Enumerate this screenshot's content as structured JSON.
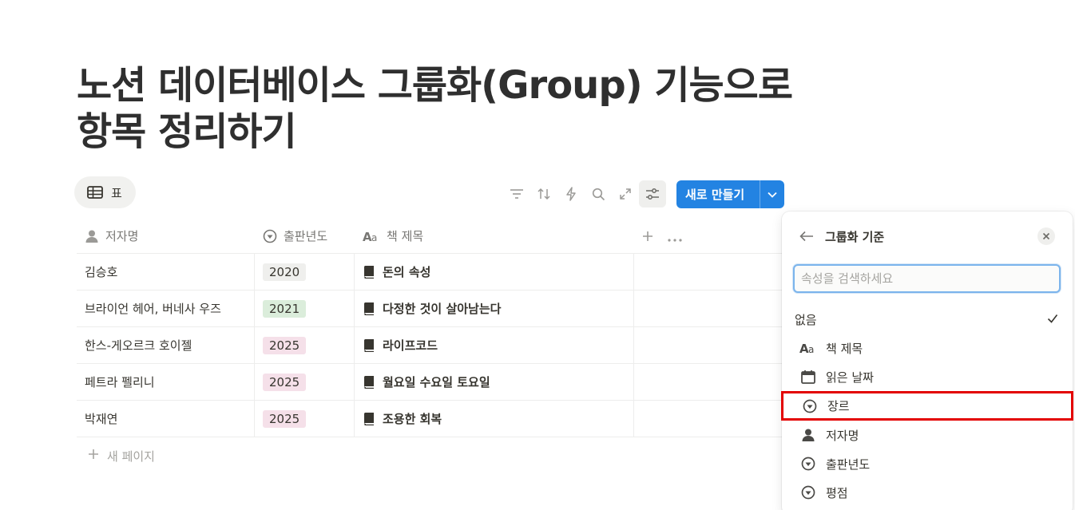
{
  "page": {
    "title": "노션 데이터베이스 그룹화(Group) 기능으로 항목 정리하기"
  },
  "view_tab": {
    "label": "표"
  },
  "toolbar": {
    "icons": [
      "filter-icon",
      "sort-icon",
      "automation-icon",
      "search-icon",
      "expand-icon",
      "settings-icon"
    ],
    "new_button_label": "새로 만들기"
  },
  "table": {
    "columns": [
      {
        "label": "저자명",
        "icon": "person-icon"
      },
      {
        "label": "출판년도",
        "icon": "select-icon"
      },
      {
        "label": "책 제목",
        "icon": "text-icon"
      }
    ],
    "rows": [
      {
        "author": "김승호",
        "year": "2020",
        "year_color": "#efefed",
        "title": "돈의 속성"
      },
      {
        "author": "브라이언 헤어, 버네사 우즈",
        "year": "2021",
        "year_color": "#dbeddb",
        "title": "다정한 것이 살아남는다"
      },
      {
        "author": "한스-게오르크 호이젤",
        "year": "2025",
        "year_color": "#f5e0e9",
        "title": "라이프코드"
      },
      {
        "author": "페트라 펠리니",
        "year": "2025",
        "year_color": "#f5e0e9",
        "title": "월요일 수요일 토요일"
      },
      {
        "author": "박재연",
        "year": "2025",
        "year_color": "#f5e0e9",
        "title": "조용한 회복"
      }
    ],
    "new_page_label": "새 페이지"
  },
  "group_panel": {
    "title": "그룹화 기준",
    "search_placeholder": "속성을 검색하세요",
    "options": [
      {
        "label": "없음",
        "icon": "",
        "selected": true
      },
      {
        "label": "책 제목",
        "icon": "text-icon"
      },
      {
        "label": "읽은 날짜",
        "icon": "calendar-icon"
      },
      {
        "label": "장르",
        "icon": "select-icon",
        "highlighted": true
      },
      {
        "label": "저자명",
        "icon": "person-icon"
      },
      {
        "label": "출판년도",
        "icon": "select-icon"
      },
      {
        "label": "평점",
        "icon": "select-icon"
      }
    ],
    "highlight_color": "#e30000"
  }
}
